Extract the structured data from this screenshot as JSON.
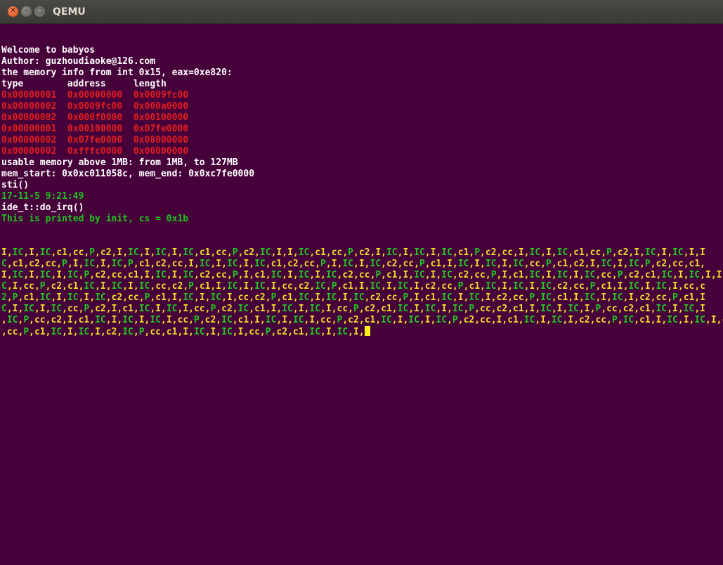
{
  "window": {
    "title": "QEMU"
  },
  "console": {
    "lines": [
      {
        "text": "Welcome to babyos",
        "color": "#ffffff"
      },
      {
        "text": "Author: guzhoudiaoke@126.com",
        "color": "#ffffff"
      },
      {
        "text": "the memory info from int 0x15, eax=0xe820:",
        "color": "#ffffff"
      },
      {
        "text": "type        address     length",
        "color": "#ffffff"
      },
      {
        "text": "0x00000001  0x00000000  0x0009fc00",
        "color": "#e01f1f"
      },
      {
        "text": "0x00000002  0x0009fc00  0x000a0000",
        "color": "#e01f1f"
      },
      {
        "text": "0x00000002  0x000f0000  0x00100000",
        "color": "#e01f1f"
      },
      {
        "text": "0x00000001  0x00100000  0x07fe0000",
        "color": "#e01f1f"
      },
      {
        "text": "0x00000002  0x07fe0000  0x08000000",
        "color": "#e01f1f"
      },
      {
        "text": "0x00000002  0xfffc0000  0x00000000",
        "color": "#e01f1f"
      },
      {
        "text": "usable memory above 1MB: from 1MB, to 127MB",
        "color": "#ffffff"
      },
      {
        "text": "mem_start: 0x0xc011058c, mem_end: 0x0xc7fe0000",
        "color": "#ffffff"
      },
      {
        "text": "sti()",
        "color": "#ffffff"
      },
      {
        "text": "17-11-5 9:21:49",
        "color": "#1ec61e"
      },
      {
        "text": "ide_t::do_irq()",
        "color": "#ffffff"
      },
      {
        "text": "This is printed by init, cs = 0x1b",
        "color": "#1ec61e"
      }
    ],
    "irq_lines": [
      "I,IC,I,IC,c1,cc,P,c2,I,IC,I,IC,I,IC,c1,cc,P,c2,IC,I,I,IC,c1,cc,P,c2,I,IC,I,IC,I,IC,c1,P,c2,cc,I,IC,I,IC,c1,cc,P,c2,I,IC,I,IC,I,I",
      "C,c1,c2,cc,P,I,IC,I,IC,P,c1,c2,cc,I,IC,I,IC,I,IC,c1,c2,cc,P,I,IC,I,IC,c2,cc,P,c1,I,IC,I,IC,I,IC,cc,P,c1,c2,I,IC,I,IC,P,c2,cc,c1,",
      "I,IC,I,IC,I,IC,P,c2,cc,c1,I,IC,I,IC,c2,cc,P,I,c1,IC,I,IC,I,IC,c2,cc,P,c1,I,IC,I,IC,c2,cc,P,I,c1,IC,I,IC,I,IC,cc,P,c2,c1,IC,I,IC,I,I",
      "C,I,cc,P,c2,c1,IC,I,IC,I,IC,cc,c2,P,c1,I,IC,I,IC,I,cc,c2,IC,P,c1,I,IC,I,IC,I,c2,cc,P,c1,IC,I,IC,I,IC,c2,cc,P,c1,I,IC,I,IC,I,cc,c",
      "2,P,c1,IC,I,IC,I,IC,c2,cc,P,c1,I,IC,I,IC,I,cc,c2,P,c1,IC,I,IC,I,IC,c2,cc,P,I,c1,IC,I,IC,I,c2,cc,P,IC,c1,I,IC,I,IC,I,c2,cc,P,c1,I",
      "C,I,IC,I,IC,cc,P,c2,I,c1,IC,I,IC,I,cc,P,c2,IC,c1,I,IC,I,IC,I,cc,P,c2,c1,IC,I,IC,I,IC,P,cc,c2,c1,I,IC,I,IC,I,P,cc,c2,c1,IC,I,IC,I",
      ",IC,P,cc,c2,I,c1,IC,I,IC,I,IC,I,cc,P,c2,IC,c1,I,IC,I,IC,I,cc,P,c2,c1,IC,I,IC,I,IC,P,c2,cc,I,c1,IC,I,IC,I,c2,cc,P,IC,c1,I,IC,I,IC,I,c2",
      ",cc,P,c1,IC,I,IC,I,c2,IC,P,cc,c1,I,IC,I,IC,I,cc,P,c2,c1,IC,I,IC,I,"
    ],
    "irq_colors": {
      "green": "#22c922",
      "yellow": "#f0e02a"
    }
  }
}
